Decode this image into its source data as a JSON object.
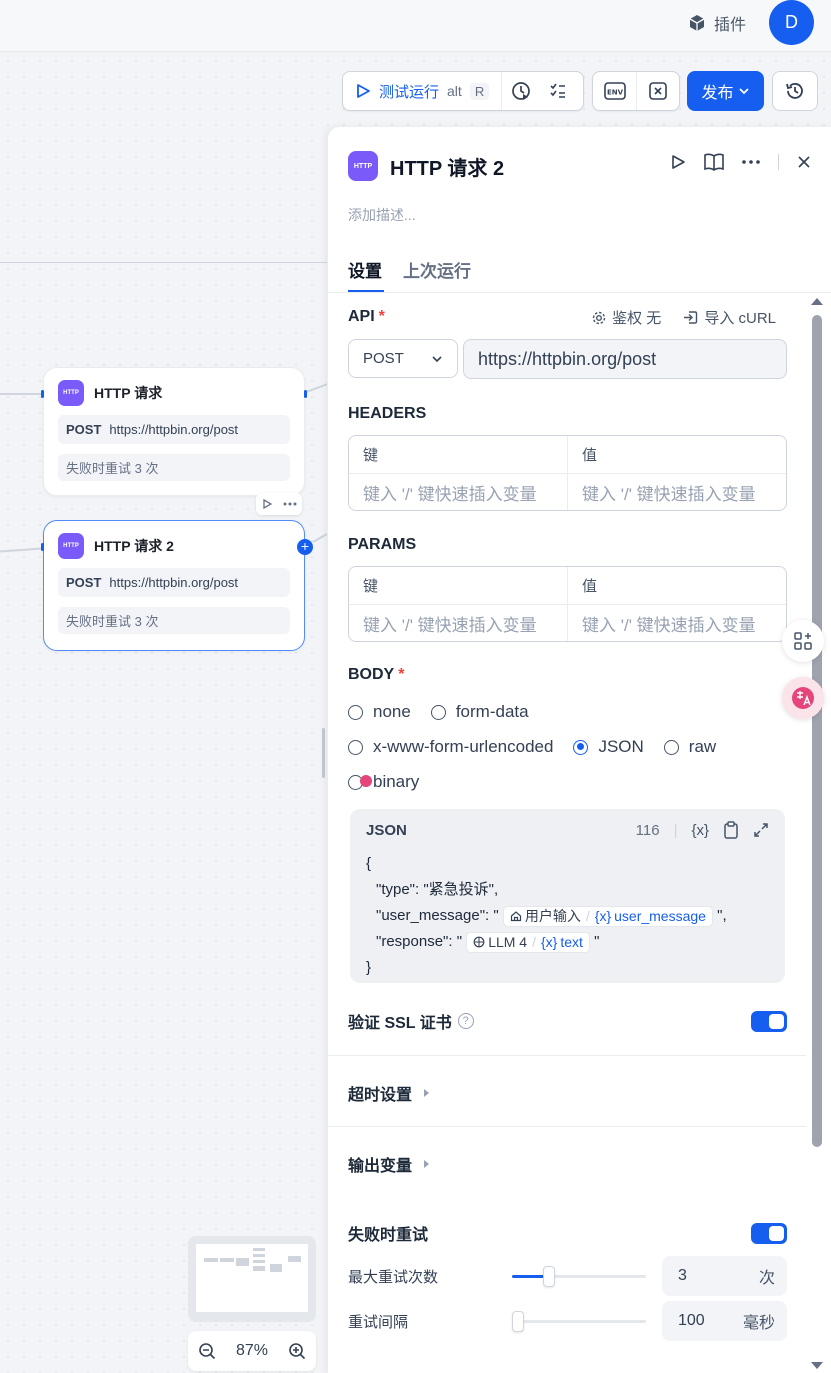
{
  "header": {
    "plugin_label": "插件",
    "avatar_initial": "D"
  },
  "toolbar": {
    "run_label": "测试运行",
    "shortcut_mod": "alt",
    "shortcut_key": "R",
    "env_label": "ENV",
    "publish_label": "发布"
  },
  "nodes": [
    {
      "title": "HTTP 请求",
      "method": "POST",
      "url": "https://httpbin.org/post",
      "retry": "失败时重试 3 次"
    },
    {
      "title": "HTTP 请求 2",
      "method": "POST",
      "url": "https://httpbin.org/post",
      "retry": "失败时重试 3 次"
    }
  ],
  "http_badge": "HTTP",
  "zoom": {
    "level": "87%"
  },
  "panel": {
    "title": "HTTP 请求 2",
    "description_placeholder": "添加描述...",
    "tabs": {
      "settings": "设置",
      "last_run": "上次运行"
    },
    "api": {
      "label": "API",
      "required_mark": "*",
      "auth_label": "鉴权 无",
      "import_label": "导入 cURL",
      "method": "POST",
      "url": "https://httpbin.org/post"
    },
    "headers": {
      "label": "HEADERS",
      "key_col": "键",
      "value_col": "值",
      "key_placeholder": "键入 '/' 键快速插入变量",
      "value_placeholder": "键入 '/' 键快速插入变量"
    },
    "params": {
      "label": "PARAMS",
      "key_col": "键",
      "value_col": "值",
      "key_placeholder": "键入 '/' 键快速插入变量",
      "value_placeholder": "键入 '/' 键快速插入变量"
    },
    "body": {
      "label": "BODY",
      "required_mark": "*",
      "options": [
        "none",
        "form-data",
        "x-www-form-urlencoded",
        "JSON",
        "raw",
        "binary"
      ],
      "selected": "JSON",
      "json": {
        "title": "JSON",
        "char_count": "116",
        "var_symbol": "{x}",
        "open_brace": "{",
        "close_brace": "}",
        "line1": "\"type\": \"紧急投诉\",",
        "line2_prefix": "\"user_message\": \"",
        "line2_suffix": "\",",
        "line3_prefix": "\"response\": \"",
        "line3_suffix": "\"",
        "var1_node": "用户输入",
        "var1_name": "user_message",
        "var2_node": "LLM 4",
        "var2_name": "text"
      }
    },
    "ssl": {
      "label": "验证 SSL 证书",
      "help": "?",
      "enabled": true
    },
    "timeout": {
      "label": "超时设置"
    },
    "output_vars": {
      "label": "输出变量"
    },
    "retry": {
      "label": "失败时重试",
      "enabled": true,
      "max_retries_label": "最大重试次数",
      "max_retries_value": "3",
      "max_retries_unit": "次",
      "max_retries_fraction": 0.25,
      "interval_label": "重试间隔",
      "interval_value": "100",
      "interval_unit": "毫秒",
      "interval_fraction": 0.0
    }
  },
  "colors": {
    "accent": "#155eef",
    "http_badge": "#7a5af8",
    "required": "#f04438"
  }
}
